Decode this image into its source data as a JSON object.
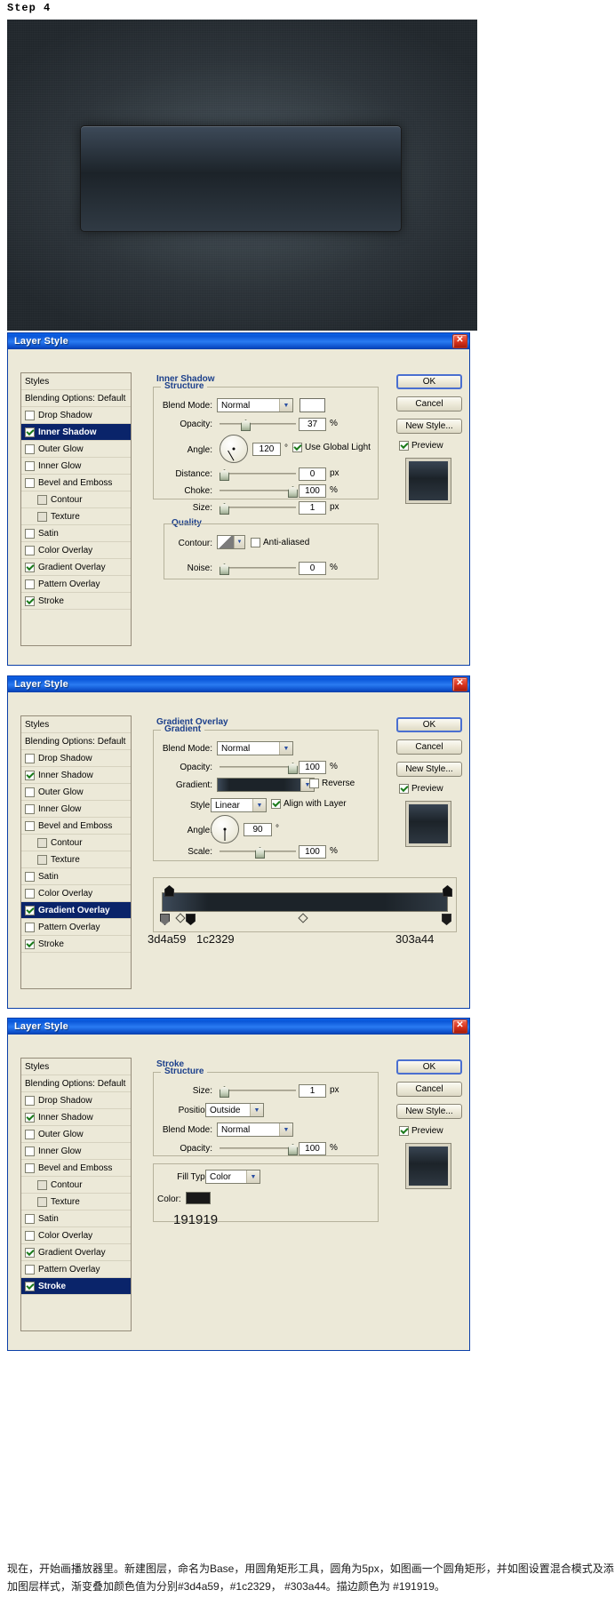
{
  "step_title": "Step 4",
  "artwork": {
    "name": "photoshop-player-preview",
    "shape_gradient": [
      "#3d4a59",
      "#1c2329",
      "#303a44"
    ],
    "stroke_color": "#191919"
  },
  "common": {
    "dialog_title": "Layer Style",
    "close_glyph": "✕",
    "ok": "OK",
    "cancel": "Cancel",
    "new_style": "New Style...",
    "preview": "Preview",
    "styles_header": "Styles",
    "blending_options": "Blending Options: Default",
    "degree": "°",
    "percent": "%",
    "px": "px",
    "combo_arrow": "▼"
  },
  "styles_items": [
    {
      "label": "Drop Shadow",
      "checked": false,
      "indent": false
    },
    {
      "label": "Inner Shadow",
      "checked": true,
      "indent": false
    },
    {
      "label": "Outer Glow",
      "checked": false,
      "indent": false
    },
    {
      "label": "Inner Glow",
      "checked": false,
      "indent": false
    },
    {
      "label": "Bevel and Emboss",
      "checked": false,
      "indent": false
    },
    {
      "label": "Contour",
      "checked": false,
      "indent": true
    },
    {
      "label": "Texture",
      "checked": false,
      "indent": true
    },
    {
      "label": "Satin",
      "checked": false,
      "indent": false
    },
    {
      "label": "Color Overlay",
      "checked": false,
      "indent": false
    },
    {
      "label": "Gradient Overlay",
      "checked": true,
      "indent": false
    },
    {
      "label": "Pattern Overlay",
      "checked": false,
      "indent": false
    },
    {
      "label": "Stroke",
      "checked": true,
      "indent": false
    }
  ],
  "dialog1": {
    "selected_style": "Inner Shadow",
    "section_title": "Inner Shadow",
    "sub_section": "Structure",
    "blend_mode_label": "Blend Mode:",
    "blend_mode_value": "Normal",
    "shadow_color": "#ffffff",
    "opacity_label": "Opacity:",
    "opacity_value": "37",
    "angle_label": "Angle:",
    "angle_value": "120",
    "use_global_light": "Use Global Light",
    "use_global_light_checked": true,
    "distance_label": "Distance:",
    "distance_value": "0",
    "choke_label": "Choke:",
    "choke_value": "100",
    "size_label": "Size:",
    "size_value": "1",
    "quality_title": "Quality",
    "contour_label": "Contour:",
    "anti_aliased": "Anti-aliased",
    "anti_aliased_checked": false,
    "noise_label": "Noise:",
    "noise_value": "0"
  },
  "dialog2": {
    "selected_style": "Gradient Overlay",
    "section_title": "Gradient Overlay",
    "sub_section": "Gradient",
    "blend_mode_label": "Blend Mode:",
    "blend_mode_value": "Normal",
    "opacity_label": "Opacity:",
    "opacity_value": "100",
    "gradient_label": "Gradient:",
    "reverse_label": "Reverse",
    "reverse_checked": false,
    "style_label": "Style:",
    "style_value": "Linear",
    "align_with_layer": "Align with Layer",
    "align_checked": true,
    "angle_label": "Angle:",
    "angle_value": "90",
    "scale_label": "Scale:",
    "scale_value": "100",
    "gradient_stops": [
      "3d4a59",
      "1c2329",
      "303a44"
    ],
    "gradient_colors": [
      "#3d4a59",
      "#1c2329",
      "#303a44"
    ]
  },
  "dialog3": {
    "selected_style": "Stroke",
    "section_title": "Stroke",
    "sub_section": "Structure",
    "size_label": "Size:",
    "size_value": "1",
    "position_label": "Position:",
    "position_value": "Outside",
    "blend_mode_label": "Blend Mode:",
    "blend_mode_value": "Normal",
    "opacity_label": "Opacity:",
    "opacity_value": "100",
    "fill_type_label": "Fill Type:",
    "fill_type_value": "Color",
    "color_label": "Color:",
    "color_value": "#191919",
    "color_hex_text": "191919"
  },
  "caption": {
    "line1": "现在，开始画播放器里。新建图层，命名为Base，用圆角矩形工具，圆角为5px，如图画一个圆角矩形，并如图设置混合模式及添",
    "line2": "加图层样式，渐变叠加颜色值为分别#3d4a59，#1c2329， #303a44。描边颜色为 #191919。"
  }
}
